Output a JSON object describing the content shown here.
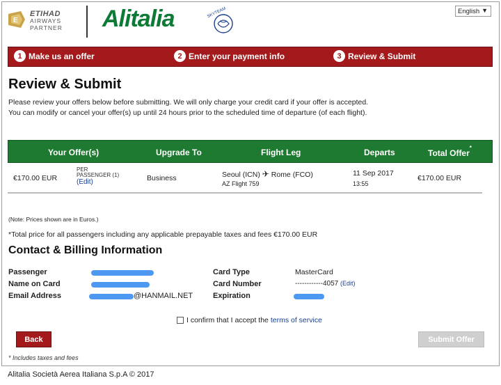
{
  "header": {
    "etihad_line1": "ETIHAD",
    "etihad_line2": "AIRWAYS",
    "etihad_line3": "PARTNER",
    "brand": "Alitalia",
    "skyteam": "SKYTEAM",
    "language": "English"
  },
  "steps": [
    {
      "num": "1",
      "label": "Make us an offer"
    },
    {
      "num": "2",
      "label": "Enter your payment info"
    },
    {
      "num": "3",
      "label": "Review & Submit"
    }
  ],
  "page": {
    "title": "Review & Submit",
    "intro_line1": "Please review your offers below before submitting. We will only charge your credit card if your offer is accepted.",
    "intro_line2": "You can modify or cancel your offer(s) up until 24 hours prior to the scheduled time of departure (of each flight)."
  },
  "table": {
    "headers": {
      "offer": "Your Offer(s)",
      "upgrade": "Upgrade To",
      "leg": "Flight Leg",
      "departs": "Departs",
      "total": "Total Offer",
      "total_mark": "*"
    },
    "row": {
      "offer": "€170.00 EUR",
      "per_line1": "PER",
      "per_line2": "PASSENGER (1)",
      "edit": "(Edit)",
      "upgrade": "Business",
      "route_from": "Seoul (ICN)",
      "route_to": "Rome (FCO)",
      "flight": "AZ Flight 759",
      "date": "11 Sep 2017",
      "time": "13:55",
      "total": "€170.00 EUR"
    }
  },
  "note": "(Note: Prices shown are in Euros.)",
  "total_line": "*Total price for all passengers including any applicable prepayable taxes and fees €170.00 EUR",
  "contact": {
    "title": "Contact & Billing Information",
    "passenger_label": "Passenger",
    "name_label": "Name on Card",
    "email_label": "Email Address",
    "email_suffix": "@HANMAIL.NET",
    "card_type_label": "Card Type",
    "card_type": "MasterCard",
    "card_number_label": "Card Number",
    "card_number": "------------4057",
    "card_edit": "(Edit)",
    "expiration_label": "Expiration"
  },
  "confirm": {
    "text": "I confirm that I accept the",
    "link": "terms of service"
  },
  "buttons": {
    "back": "Back",
    "submit": "Submit Offer"
  },
  "footnote": "* Includes taxes and fees",
  "copyright": "Alitalia Società Aerea Italiana S.p.A © 2017",
  "colors": {
    "brand_red": "#a4191b",
    "brand_green": "#1e7a30",
    "link_blue": "#1a3f8f"
  }
}
